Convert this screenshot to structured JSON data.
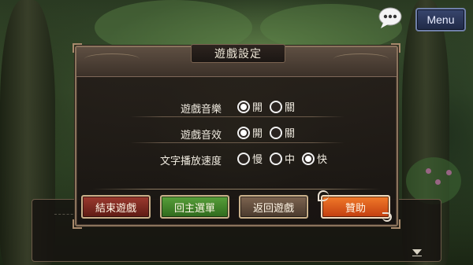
{
  "top_bar": {
    "menu_label": "Menu",
    "chat_icon": "speech-bubble-icon"
  },
  "settings": {
    "title": "遊戲設定",
    "rows": [
      {
        "label": "遊戲音樂",
        "options": [
          {
            "label": "開",
            "selected": true
          },
          {
            "label": "關",
            "selected": false
          }
        ]
      },
      {
        "label": "遊戲音效",
        "options": [
          {
            "label": "開",
            "selected": true
          },
          {
            "label": "關",
            "selected": false
          }
        ]
      },
      {
        "label": "文字播放速度",
        "options": [
          {
            "label": "慢",
            "selected": false
          },
          {
            "label": "中",
            "selected": false
          },
          {
            "label": "快",
            "selected": true
          }
        ]
      }
    ],
    "buttons": {
      "end_game": "結束遊戲",
      "main_menu": "回主選單",
      "return_game": "返回遊戲",
      "sponsor": "贊助"
    }
  },
  "colors": {
    "end_button": "#7a2a22",
    "main_menu_button": "#3f8428",
    "return_button": "#5f4c3d",
    "sponsor_button": "#e05a1c",
    "menu_button": "#2b3658"
  }
}
